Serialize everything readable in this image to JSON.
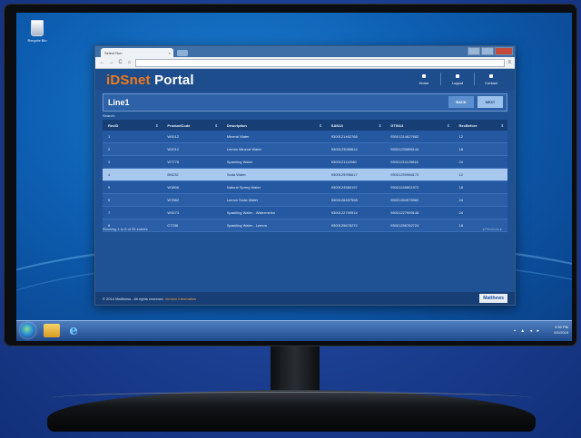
{
  "desktop": {
    "recycle_bin_label": "Recycle Bin"
  },
  "browser": {
    "tab_title": "Select Run",
    "tab_close": "×",
    "nav": {
      "back": "←",
      "forward": "→",
      "reload": "C",
      "home": "⌂",
      "menu": "≡"
    }
  },
  "portal": {
    "title_main": "iDSnet",
    "title_rest": " Portal",
    "accent_color": "#f07a1a",
    "nav": [
      "Home",
      "Logout",
      "Contact"
    ]
  },
  "line_panel": {
    "title": "Line1",
    "back_label": "BACK",
    "next_label": "NEXT"
  },
  "search_label": "Search:",
  "table": {
    "headers": [
      "RecID",
      "ProductCode",
      "Description",
      "SAN13",
      "GTIN14",
      "RecBefore"
    ],
    "rows": [
      [
        "1",
        "W0012",
        "Mineral Water",
        "9300121462768",
        "93001214627682",
        "12"
      ],
      [
        "2",
        "W2012",
        "Lemon Mineral Water",
        "9300123085614",
        "93001230856144",
        "18"
      ],
      [
        "3",
        "W7778",
        "Sparkling Water",
        "9300121112981",
        "93001211129816",
        "24"
      ],
      [
        "4",
        "BN232",
        "Soda Water",
        "9300125996617",
        "93001259966172",
        "12"
      ],
      [
        "5",
        "W3806",
        "Natural Spring Water",
        "9300124580197",
        "93001245801972",
        "18"
      ],
      [
        "6",
        "W7882",
        "Lemon Soda Water",
        "9300126497558",
        "93001264975582",
        "24"
      ],
      [
        "7",
        "W9273",
        "Sparkling Water - Watermelon",
        "9300122799914",
        "93001227999146",
        "24"
      ],
      [
        "8",
        "C7236",
        "Sparkling Water - Lemon",
        "9300125676272",
        "93001256762724",
        "18"
      ]
    ],
    "selected_row": 3
  },
  "table_info": "Showing 1 to 8 of 26 entries",
  "pager_label": "◂ Previous ▸",
  "footer": {
    "copyright": "© 2014 Matthews - All rights reserved.",
    "link": "Version Information",
    "brand": "Matthews"
  },
  "taskbar": {
    "tray": "▪ ▲ ◂ ▸",
    "time": "4:30 PM",
    "date": "6/1/2015"
  }
}
